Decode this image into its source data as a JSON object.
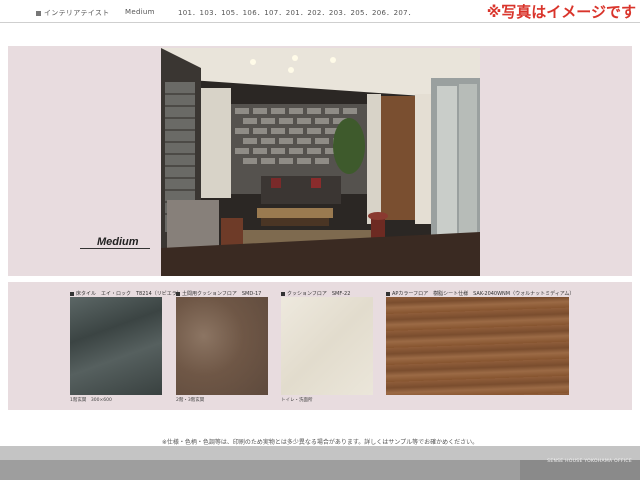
{
  "header": {
    "section_label": "インテリアテイスト",
    "style": "Medium",
    "units": "101．103．105．106．107．201．202．203．205．206．207．",
    "notice": "※写真はイメージです"
  },
  "photo": {
    "caption": "Medium"
  },
  "swatches": [
    {
      "label": "床タイル　エイ・ロック　T8214（リビエラ）",
      "note": "1階玄関　300×600",
      "color": "#4a5352"
    },
    {
      "label": "土間用クッションフロア　SMD-17",
      "note": "2階・3階玄関",
      "color": "#7a6353"
    },
    {
      "label": "クッションフロア　SMF-22",
      "note": "トイレ・洗面所",
      "color": "#e8e3d6"
    },
    {
      "label": "APカラーフロア　樹脂シート仕様　SAK-2040WNM（ウォルナットミディアム）",
      "note": "",
      "color": "#8a5a38"
    }
  ],
  "disclaimer": "※仕様・色柄・色調等は、印刷のため実物とは多少異なる場合があります。詳しくはサンプル等でお確かめください。",
  "footer": {
    "text": "SENSE HOUSE YOKOHAMA OFFICE"
  }
}
